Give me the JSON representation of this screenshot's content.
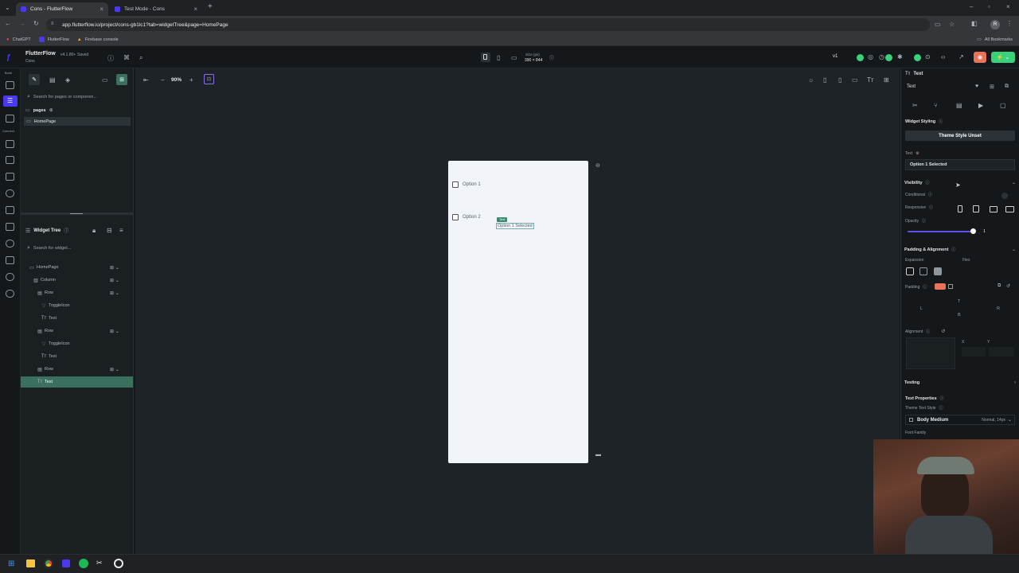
{
  "browser": {
    "tabs": [
      {
        "label": "Cons - FlutterFlow",
        "active": true
      },
      {
        "label": "Test Mode - Cons",
        "active": false
      }
    ],
    "new_tab": "+",
    "url": "app.flutterflow.io/project/cons-gb1lc1?tab=widgetTree&page=HomePage",
    "bookmarks": [
      "ChatGPT",
      "FlutterFlow",
      "Firebase console"
    ],
    "all_bookmarks": "All Bookmarks",
    "profile_initial": "R"
  },
  "app": {
    "brand": "FlutterFlow",
    "version": "v4.1.80+",
    "saved": "Saved",
    "project": "Cons",
    "size_label": "Size (px)",
    "size_value": "390 × 844",
    "version_select": "v1"
  },
  "leftnav": {
    "build": "Build",
    "connect": "Connect"
  },
  "pages_panel": {
    "search_placeholder": "Search for pages or componen...",
    "pages_label": "pages",
    "homepage": "HomePage"
  },
  "widget_tree": {
    "title": "Widget Tree",
    "search_placeholder": "Search for widget...",
    "items": [
      {
        "label": "HomePage",
        "indent": 0
      },
      {
        "label": "Column",
        "indent": 1
      },
      {
        "label": "Row",
        "indent": 2
      },
      {
        "label": "ToggleIcon",
        "indent": 3
      },
      {
        "label": "Text",
        "indent": 3
      },
      {
        "label": "Row",
        "indent": 2
      },
      {
        "label": "ToggleIcon",
        "indent": 3
      },
      {
        "label": "Text",
        "indent": 3
      },
      {
        "label": "Row",
        "indent": 2
      },
      {
        "label": "Text",
        "indent": 2,
        "selected": true
      }
    ]
  },
  "canvas": {
    "zoom": "90%",
    "option1": "Option 1",
    "option2": "Option 2",
    "text_badge": "Text",
    "selected_text": "Option 1 Selected"
  },
  "properties": {
    "widget_type": "Text",
    "widget_name": "Text",
    "widget_styling": "Widget Styling",
    "theme_style_unset": "Theme Style Unset",
    "text_label": "Text",
    "text_value": "Option 1 Selected",
    "visibility": "Visibility",
    "conditional": "Conditional",
    "responsive": "Responsive",
    "opacity": "Opacity",
    "opacity_value": "1",
    "padding_alignment": "Padding & Alignment",
    "expansion": "Expansion",
    "flex": "Flex",
    "padding": "Padding",
    "pad_t": "T",
    "pad_l": "L",
    "pad_r": "R",
    "pad_b": "B",
    "alignment": "Alignment",
    "align_x": "X",
    "align_y": "Y",
    "testing": "Testing",
    "text_properties": "Text Properties",
    "theme_text_style": "Theme Text Style",
    "body_medium": "Body Medium",
    "body_medium_meta": "Normal, 14px",
    "font_family": "Font Family"
  },
  "colors": {
    "accent_green": "#3b6f5f",
    "brand_purple": "#4b39ef",
    "slider_blue": "#5b50e8",
    "canvas_bg": "#1d2326"
  }
}
